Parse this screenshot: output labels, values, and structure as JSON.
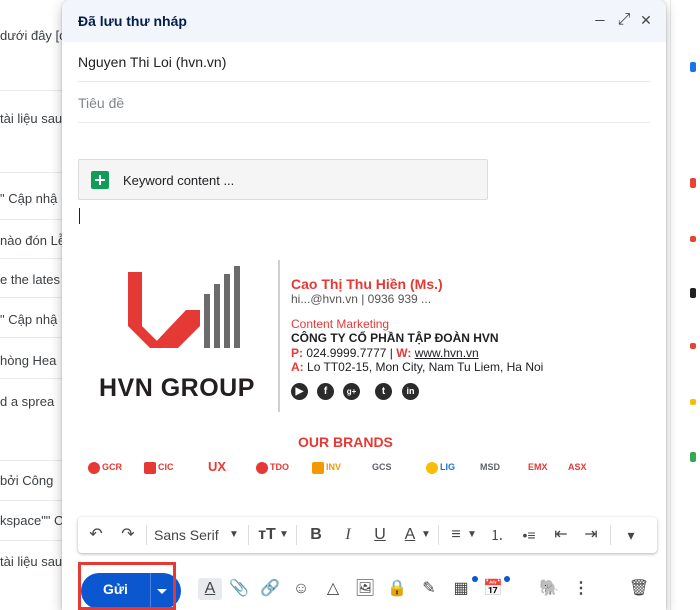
{
  "background_list": {
    "items": [
      "dưới đây [c",
      "tài liệu sau",
      "\" Cập nhậ",
      "nào đón Lễ",
      "e the lates",
      "\" Cập nhậ",
      "hòng Hea",
      "d a sprea",
      "bởi Công",
      "kspace\"\" C",
      "tài liệu sau"
    ]
  },
  "compose": {
    "title": "Đã lưu thư nháp",
    "minimize_label": "_",
    "expand_label": "⤢",
    "close_label": "✕",
    "to_value": "Nguyen Thi Loi (hvn.vn)",
    "subject_placeholder": "Tiêu đề",
    "attachment_name": "Keyword content ...",
    "signature": {
      "logo_text": "HVN GROUP",
      "name": "Cao Thị Thu Hiền (Ms.)",
      "contact": "hi...@hvn.vn | 0936 939 ...",
      "role": "Content Marketing",
      "company": "CÔNG TY CỔ PHẦN TẬP ĐOÀN HVN",
      "phone_label": "P:",
      "phone_value": "024.9999.7777",
      "web_sep": "|",
      "web_label": "W:",
      "web_value": "www.hvn.vn",
      "addr_label": "A:",
      "addr_value": "Lo TT02-15, Mon City, Nam Tu Liem, Ha Noi",
      "social": [
        "▶",
        "f",
        "g+",
        "t",
        "in"
      ],
      "brands_title": "OUR BRANDS",
      "brands": [
        "GCR",
        "CIC",
        "UX",
        "TDO",
        "INV",
        "GCS",
        "LIG",
        "MSD",
        "EMX",
        "ASX"
      ]
    },
    "format_bar": {
      "undo": "↶",
      "redo": "↷",
      "font": "Sans Serif",
      "size": "тT",
      "bold": "B",
      "italic": "I",
      "underline": "U",
      "text_color": "A",
      "align": "≡",
      "numbered": "⒈",
      "bulleted": "•≡",
      "indent_less": "⇤",
      "indent_more": "⇥",
      "more": "▾"
    },
    "bottom_bar": {
      "send": "Gửi",
      "format_toggle": "A",
      "attach": "📎",
      "link": "🔗",
      "emoji": "☺",
      "drive": "△",
      "photo": "🖼",
      "confidential": "🔒",
      "signature": "✎",
      "layout": "▦",
      "schedule": "📅",
      "evernote": "🐘",
      "more": "⋮",
      "delete": "🗑"
    }
  },
  "colors": {
    "accent": "#0b57d0",
    "brand_red": "#e53935",
    "header_bg": "#f2f6fc"
  }
}
